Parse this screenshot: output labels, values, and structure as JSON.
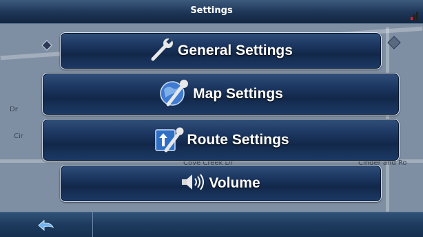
{
  "title": "Settings",
  "menu": {
    "general": "General Settings",
    "map": "Map Settings",
    "route": "Route Settings",
    "volume": "Volume"
  },
  "map_labels": {
    "left_1": "Dr",
    "left_2": "Cir",
    "road_center": "Cove Creek Dr",
    "road_right": "Cinder and Ro"
  },
  "icons": {
    "general": "wrench-icon",
    "map": "globe-wrench-icon",
    "route": "route-sign-wrench-icon",
    "volume": "speaker-icon",
    "back": "back-arrow-icon",
    "signal": "signal-strength-icon"
  },
  "colors": {
    "button_bg": "#1b3660",
    "button_border": "#d8e2ee",
    "bar": "#1d3556",
    "signal_red": "#e52020"
  }
}
